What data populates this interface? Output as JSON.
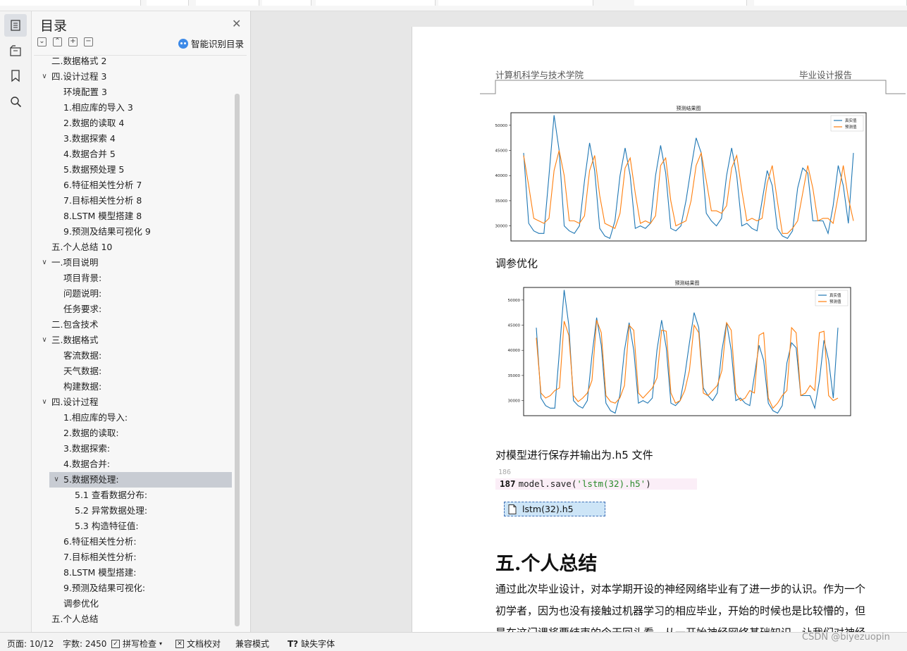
{
  "toc": {
    "title": "目录",
    "smart_label": "智能识别目录",
    "items": [
      {
        "label": "二.数据格式 2",
        "level": 1,
        "caret": ""
      },
      {
        "label": "四.设计过程 3",
        "level": 1,
        "caret": "v"
      },
      {
        "label": "环境配置 3",
        "level": 2,
        "caret": ""
      },
      {
        "label": "1.相应库的导入 3",
        "level": 2,
        "caret": ""
      },
      {
        "label": "2.数据的读取 4",
        "level": 2,
        "caret": ""
      },
      {
        "label": "3.数据探索 4",
        "level": 2,
        "caret": ""
      },
      {
        "label": "4.数据合并 5",
        "level": 2,
        "caret": ""
      },
      {
        "label": "5.数据预处理 5",
        "level": 2,
        "caret": ""
      },
      {
        "label": "6.特征相关性分析 7",
        "level": 2,
        "caret": ""
      },
      {
        "label": "7.目标相关性分析 8",
        "level": 2,
        "caret": ""
      },
      {
        "label": "8.LSTM 模型搭建 8",
        "level": 2,
        "caret": ""
      },
      {
        "label": "9.预测及结果可视化 9",
        "level": 2,
        "caret": ""
      },
      {
        "label": "五.个人总结 10",
        "level": 1,
        "caret": ""
      },
      {
        "label": "一.项目说明",
        "level": 1,
        "caret": "v"
      },
      {
        "label": "项目背景:",
        "level": 2,
        "caret": ""
      },
      {
        "label": "问题说明:",
        "level": 2,
        "caret": ""
      },
      {
        "label": "任务要求:",
        "level": 2,
        "caret": ""
      },
      {
        "label": "二.包含技术",
        "level": 1,
        "caret": ""
      },
      {
        "label": "三.数据格式",
        "level": 1,
        "caret": "v"
      },
      {
        "label": "客流数据:",
        "level": 2,
        "caret": ""
      },
      {
        "label": "天气数据:",
        "level": 2,
        "caret": ""
      },
      {
        "label": "构建数据:",
        "level": 2,
        "caret": ""
      },
      {
        "label": "四.设计过程",
        "level": 1,
        "caret": "v"
      },
      {
        "label": "1.相应库的导入:",
        "level": 2,
        "caret": ""
      },
      {
        "label": "2.数据的读取:",
        "level": 2,
        "caret": ""
      },
      {
        "label": "3.数据探索:",
        "level": 2,
        "caret": ""
      },
      {
        "label": "4.数据合并:",
        "level": 2,
        "caret": ""
      },
      {
        "label": "5.数据预处理:",
        "level": 2,
        "caret": "v",
        "selected": true
      },
      {
        "label": "5.1 查看数据分布:",
        "level": 3,
        "caret": ""
      },
      {
        "label": "5.2 异常数据处理:",
        "level": 3,
        "caret": ""
      },
      {
        "label": "5.3 构造特征值:",
        "level": 3,
        "caret": ""
      },
      {
        "label": "6.特征相关性分析:",
        "level": 2,
        "caret": ""
      },
      {
        "label": "7.目标相关性分析:",
        "level": 2,
        "caret": ""
      },
      {
        "label": "8.LSTM 模型搭建:",
        "level": 2,
        "caret": ""
      },
      {
        "label": "9.预测及结果可视化:",
        "level": 2,
        "caret": ""
      },
      {
        "label": "调参优化",
        "level": 2,
        "caret": ""
      },
      {
        "label": "五.个人总结",
        "level": 1,
        "caret": ""
      }
    ]
  },
  "doc": {
    "header_left": "计算机科学与技术学院",
    "header_right": "毕业设计报告",
    "tuning_heading": "调参优化",
    "save_paragraph": "对模型进行保存并输出为.h5 文件",
    "code_prev_line": "186",
    "code_line_num": "187",
    "code_prefix": "model.save(",
    "code_string": "'lstm(32).h5'",
    "code_suffix": ")",
    "file_name": "lstm(32).h5",
    "section_title": "五.个人总结",
    "body_lines": [
      "通过此次毕业设计，对本学期开设的神经网络毕业有了进一步的认识。作为一个",
      "初学者，因为也没有接触过机器学习的相应毕业，开始的时候也是比较懵的，但",
      "是在这门课将要结束的今天回头看，从一开始神经网络基础知识，让我们对神经"
    ]
  },
  "status": {
    "page": "页面: 10/12",
    "words": "字数: 2450",
    "spell": "拼写检查",
    "proof": "文档校对",
    "compat": "兼容模式",
    "missing_font": "缺失字体"
  },
  "watermark": "CSDN @biyezuopin",
  "chart_data": [
    {
      "type": "line",
      "title": "预测结果图",
      "ylim": [
        27000,
        52500
      ],
      "yticks": [
        30000,
        35000,
        40000,
        45000,
        50000
      ],
      "legend_position": "top-right",
      "series": [
        {
          "name": "真实值",
          "color": "#1f77b4",
          "values": [
            44500,
            30500,
            29000,
            28500,
            28500,
            40000,
            52000,
            45000,
            30000,
            29000,
            28500,
            30000,
            39000,
            46500,
            41000,
            29500,
            28000,
            27500,
            31000,
            40000,
            45500,
            40000,
            29500,
            30000,
            29500,
            30500,
            40000,
            46000,
            40500,
            29500,
            29000,
            30000,
            35000,
            41500,
            47500,
            44500,
            32500,
            31000,
            30000,
            31500,
            40000,
            45500,
            40000,
            30000,
            30500,
            29500,
            29000,
            35000,
            41000,
            38000,
            29500,
            28000,
            27500,
            29000,
            37500,
            41500,
            40500,
            31000,
            31000,
            31000,
            28500,
            34000,
            42000,
            38000,
            30500,
            44500
          ]
        },
        {
          "name": "预测值",
          "color": "#ff7f0e",
          "values": [
            44000,
            38000,
            31500,
            31000,
            30500,
            31500,
            41000,
            45000,
            40000,
            31000,
            31000,
            30500,
            32000,
            41000,
            44000,
            36000,
            30500,
            30000,
            29500,
            32500,
            41500,
            43500,
            36500,
            30500,
            31000,
            30500,
            32000,
            42000,
            43500,
            35000,
            30000,
            30500,
            31000,
            35000,
            42000,
            44500,
            39000,
            33000,
            33000,
            32500,
            34000,
            41500,
            44000,
            37000,
            31000,
            31500,
            31000,
            31500,
            38500,
            42000,
            35000,
            28500,
            28500,
            29500,
            31000,
            36500,
            42000,
            37500,
            31000,
            31500,
            31500,
            30500,
            36000,
            42000,
            35500,
            31000
          ]
        }
      ]
    },
    {
      "type": "line",
      "title": "预测结果图",
      "ylim": [
        27000,
        52500
      ],
      "yticks": [
        30000,
        35000,
        40000,
        45000,
        50000
      ],
      "legend_position": "top-right",
      "series": [
        {
          "name": "真实值",
          "color": "#1f77b4",
          "values": [
            44500,
            30500,
            29000,
            28500,
            28500,
            40000,
            52000,
            45000,
            30000,
            29000,
            28500,
            30000,
            39000,
            46500,
            41000,
            29500,
            28000,
            27500,
            31000,
            40000,
            45500,
            40000,
            29500,
            30000,
            29500,
            30500,
            40000,
            46000,
            40500,
            29500,
            29000,
            30000,
            35000,
            41500,
            47500,
            44500,
            32500,
            31000,
            30000,
            31500,
            40000,
            45500,
            40000,
            30000,
            30500,
            29500,
            29000,
            35000,
            41000,
            38000,
            29500,
            28000,
            27500,
            29000,
            37500,
            41500,
            40500,
            31000,
            31000,
            31000,
            28500,
            34000,
            42000,
            38000,
            30500,
            44500
          ]
        },
        {
          "name": "预测值",
          "color": "#ff7f0e",
          "values": [
            42500,
            31500,
            30500,
            31000,
            32000,
            32500,
            45800,
            43000,
            31000,
            29800,
            30500,
            31500,
            34000,
            46000,
            43500,
            31000,
            29800,
            29500,
            30500,
            33000,
            45000,
            44000,
            31500,
            30500,
            31500,
            32500,
            34500,
            44000,
            43800,
            31500,
            29500,
            30000,
            32000,
            36000,
            45000,
            43500,
            31500,
            31000,
            32000,
            33000,
            36000,
            45500,
            44000,
            31500,
            30000,
            30500,
            32000,
            31500,
            43000,
            43500,
            30500,
            28500,
            29500,
            31000,
            32000,
            44500,
            43500,
            31000,
            31500,
            33000,
            32000,
            43500,
            43800,
            31000,
            30000,
            30500
          ]
        }
      ]
    }
  ]
}
